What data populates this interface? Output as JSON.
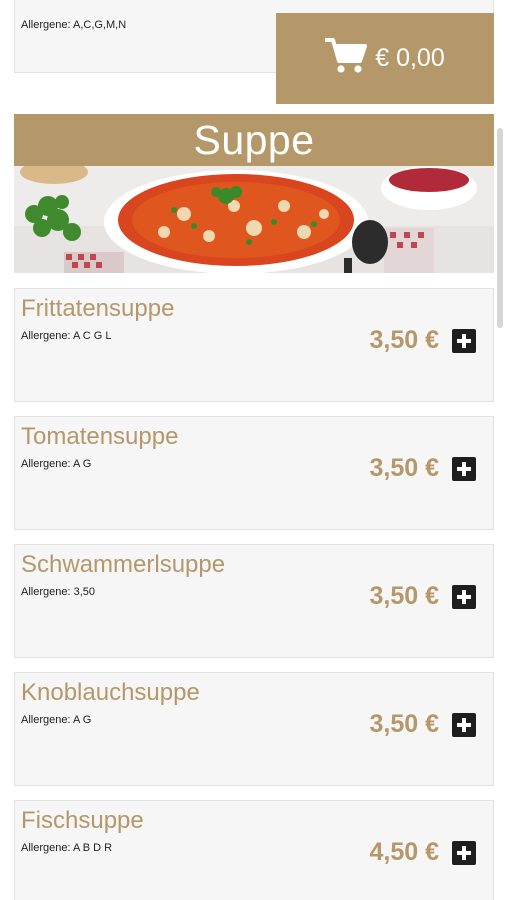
{
  "previous_item": {
    "allergen": "Allergene: A,C,G,M,N"
  },
  "cart": {
    "total": "€ 0,00",
    "icon": "shopping-cart-icon"
  },
  "category": {
    "title": "Suppe",
    "image": "tomato-soup-bowl-photo"
  },
  "items": [
    {
      "name": "Frittatensuppe",
      "allergen": "Allergene: A C G L",
      "price": "3,50 €"
    },
    {
      "name": "Tomatensuppe",
      "allergen": "Allergene: A G",
      "price": "3,50 €"
    },
    {
      "name": "Schwammerlsuppe",
      "allergen": "Allergene: 3,50",
      "price": "3,50 €"
    },
    {
      "name": "Knoblauchsuppe",
      "allergen": "Allergene: A G",
      "price": "3,50 €"
    },
    {
      "name": "Fischsuppe",
      "allergen": "Allergene: A B D R",
      "price": "4,50 €"
    }
  ],
  "colors": {
    "accent": "#b5986a",
    "card_bg": "#f6f6f6",
    "add_button": "#1e1e1e"
  }
}
